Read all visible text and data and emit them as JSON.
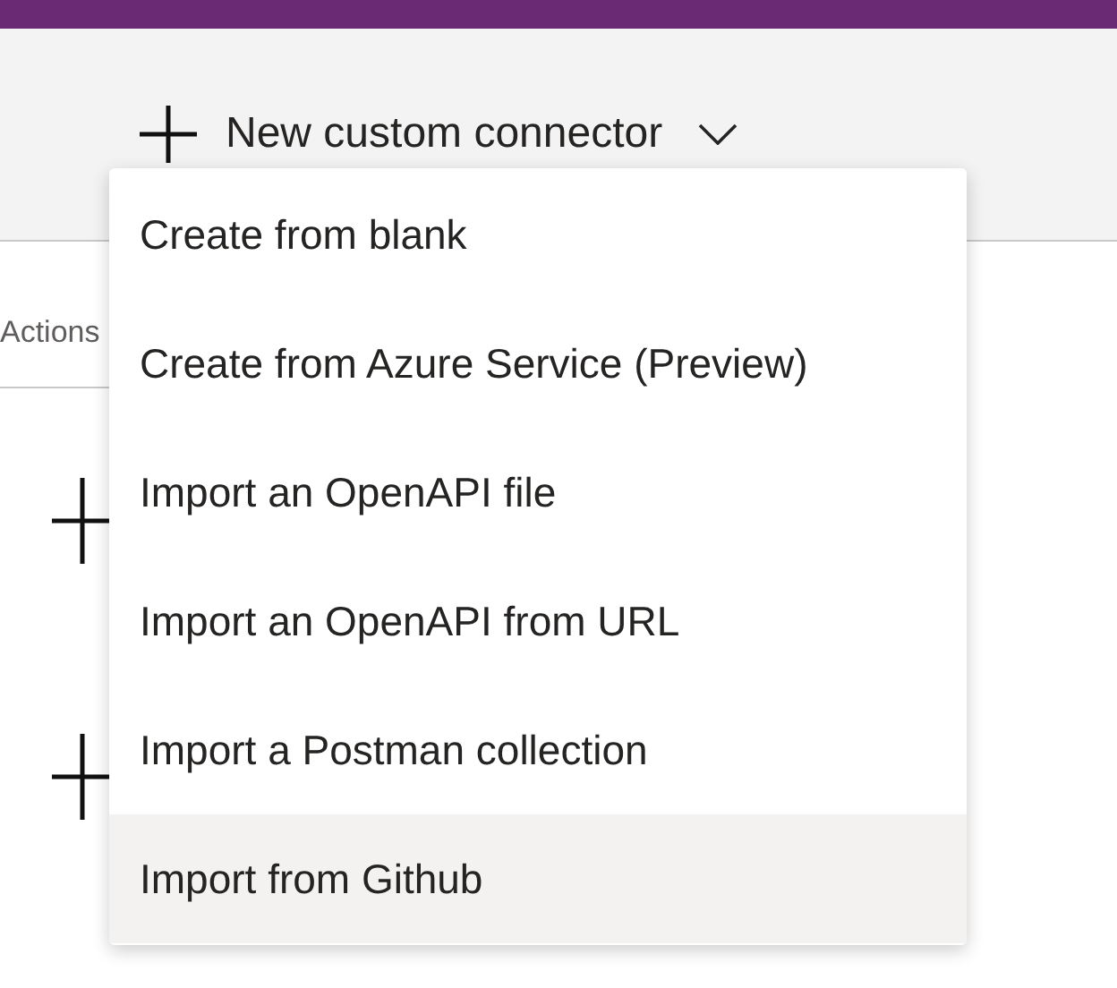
{
  "toolbar": {
    "button": {
      "label": "New custom connector",
      "expanded": true
    }
  },
  "tabs": [
    {
      "label": "Actions"
    }
  ],
  "menu": {
    "items": [
      {
        "label": "Create from blank",
        "selected": false
      },
      {
        "label": "Create from Azure Service (Preview)",
        "selected": false
      },
      {
        "label": "Import an OpenAPI file",
        "selected": false
      },
      {
        "label": "Import an OpenAPI from URL",
        "selected": false
      },
      {
        "label": "Import a Postman collection",
        "selected": false
      },
      {
        "label": "Import from Github",
        "selected": true
      }
    ]
  }
}
